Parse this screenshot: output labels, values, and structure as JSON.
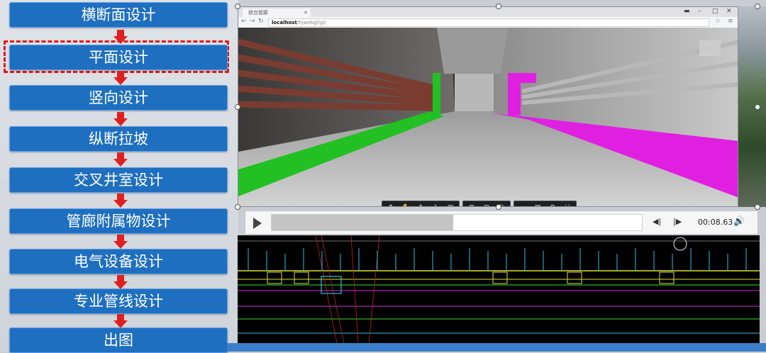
{
  "flow": {
    "steps": [
      "横断面设计",
      "平面设计",
      "竖向设计",
      "纵断拉坡",
      "交叉井室设计",
      "管廊附属物设计",
      "电气设备设计",
      "专业管线设计",
      "出图"
    ],
    "highlighted_index": 1,
    "colors": {
      "step": "#1f6fc0",
      "arrow": "#e02020",
      "highlight": "#e01818"
    }
  },
  "browser": {
    "tab_title": "综合管廊",
    "url_host": "localhost",
    "url_path": "/hjwebgl/gl/"
  },
  "player": {
    "time": "00:08.63",
    "progress": 0.49
  }
}
